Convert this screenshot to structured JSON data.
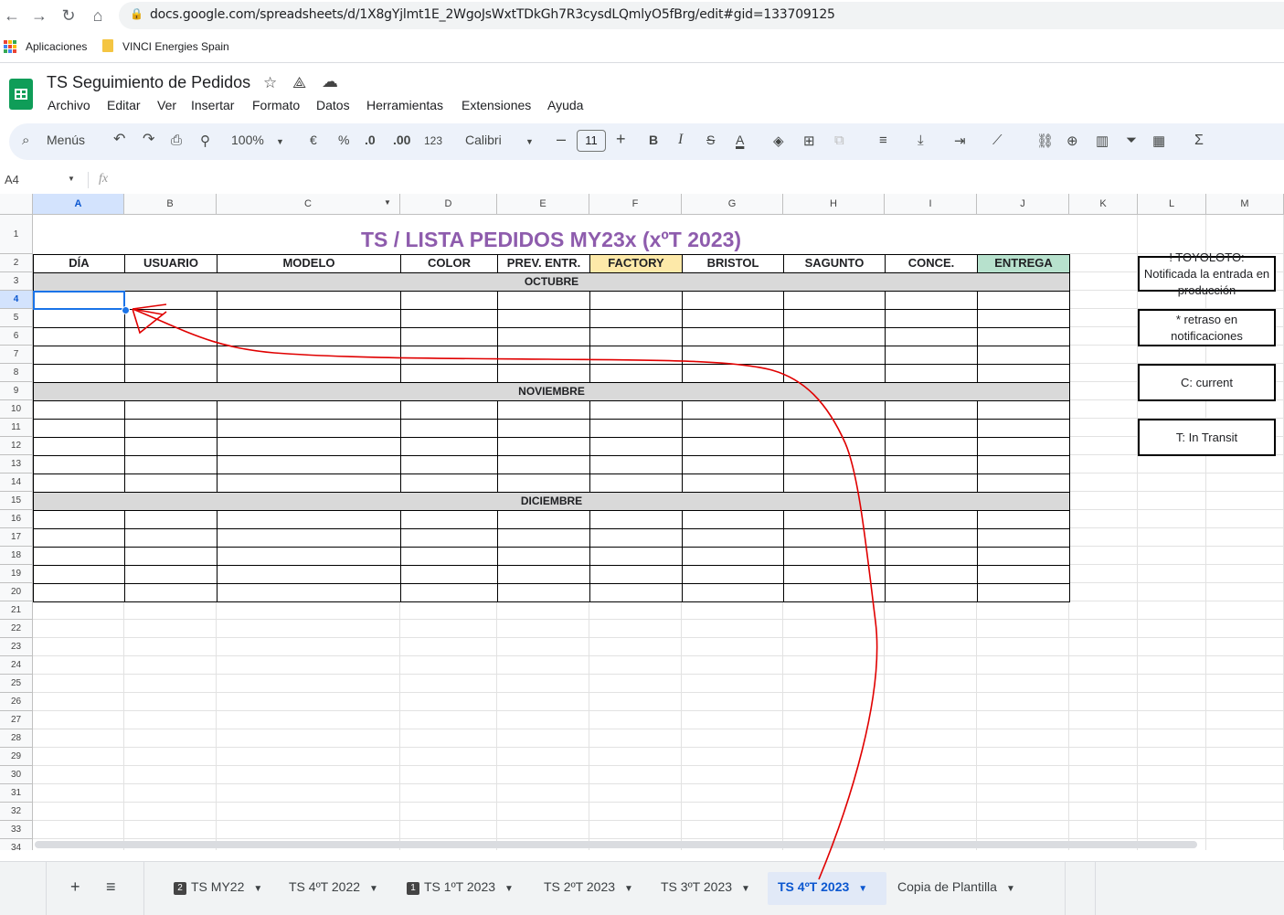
{
  "browser": {
    "url": "docs.google.com/spreadsheets/d/1X8gYjlmt1E_2WgoJsWxtTDkGh7R3cysdLQmlyO5fBrg/edit#gid=133709125",
    "bookmarks": [
      "Aplicaciones",
      "VINCI Energies Spain"
    ]
  },
  "document": {
    "title": "TS Seguimiento de Pedidos",
    "menu": [
      "Archivo",
      "Editar",
      "Ver",
      "Insertar",
      "Formato",
      "Datos",
      "Herramientas",
      "Extensiones",
      "Ayuda"
    ]
  },
  "toolbar": {
    "search_label": "Menús",
    "zoom": "100%",
    "currency": "€",
    "percent": "%",
    "decrease_decimals": ".0",
    "increase_decimals": ".00",
    "number_format": "123",
    "font": "Calibri",
    "font_size": "11"
  },
  "formula_bar": {
    "cell_ref": "A4",
    "fx": "fx"
  },
  "grid": {
    "columns": [
      "A",
      "B",
      "C",
      "D",
      "E",
      "F",
      "G",
      "H",
      "I",
      "J",
      "K",
      "L",
      "M"
    ],
    "rows": [
      "1",
      "2",
      "3",
      "4",
      "5",
      "6",
      "7",
      "8",
      "9",
      "10",
      "11",
      "12",
      "13",
      "14",
      "15",
      "16",
      "17",
      "18",
      "19",
      "20",
      "21",
      "22",
      "23",
      "24",
      "25",
      "26",
      "27",
      "28",
      "29",
      "30",
      "31",
      "32",
      "33",
      "34"
    ],
    "sheet_title": "TS / LISTA PEDIDOS MY23x (xºT 2023)",
    "headers": [
      "DÍA",
      "USUARIO",
      "MODELO",
      "COLOR",
      "PREV. ENTR.",
      "FACTORY",
      "BRISTOL",
      "SAGUNTO",
      "CONCE.",
      "ENTREGA"
    ],
    "months": [
      "OCTUBRE",
      "NOVIEMBRE",
      "DICIEMBRE"
    ],
    "legend": [
      "! TOYOLOTO: Notificada la entrada en producción",
      "* retraso en notificaciones",
      "C: current",
      "T: In Transit"
    ],
    "colors": {
      "title": "#8e5cad",
      "factory": "#fde9a9",
      "entrega": "#b7e1cd",
      "month_band": "#d9d9d9",
      "selection": "#1a73e8",
      "annotation": "#e00000"
    }
  },
  "tabs": [
    {
      "label": "TS MY22",
      "badge": "2",
      "active": false
    },
    {
      "label": "TS 4ºT 2022",
      "badge": "",
      "active": false
    },
    {
      "label": "TS 1ºT 2023",
      "badge": "1",
      "active": false
    },
    {
      "label": "TS 2ºT 2023",
      "badge": "",
      "active": false
    },
    {
      "label": "TS 3ºT 2023",
      "badge": "",
      "active": false
    },
    {
      "label": "TS 4ºT 2023",
      "badge": "",
      "active": true
    },
    {
      "label": "Copia de Plantilla",
      "badge": "",
      "active": false
    }
  ]
}
